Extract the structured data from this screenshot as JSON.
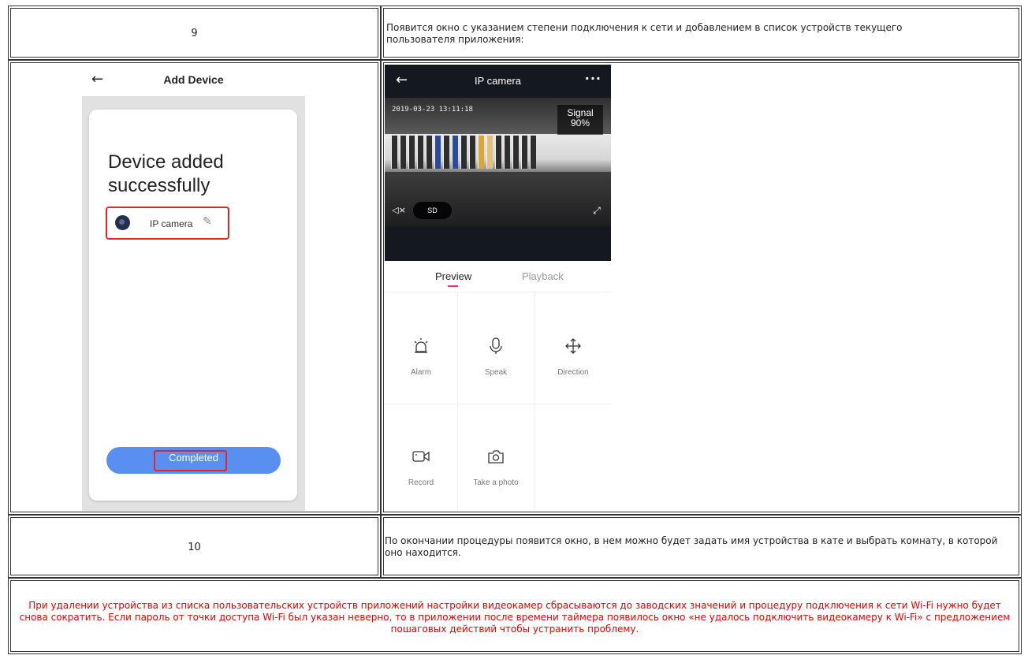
{
  "rows": [
    {
      "number": "9",
      "text": "Появится окно с указанием степени подключения к сети и добавлением в список устройств текущего пользователя приложения:"
    },
    {
      "number": "10",
      "text": "По окончании процедуры появится окно, в нем можно будет задать имя устройства в кате и выбрать комнату, в которой оно находится."
    }
  ],
  "phone_left": {
    "title": "Add Device",
    "heading_line1": "Device added",
    "heading_line2": "successfully",
    "device_name": "IP camera",
    "button_label": "Completed",
    "icons": {
      "back": "arrow-left-icon",
      "camera": "camera-lens-icon",
      "edit": "pencil-icon"
    }
  },
  "phone_right": {
    "title": "IP camera",
    "more": "···",
    "timestamp": "2019-03-23 13:11:18",
    "signal_label": "Signal",
    "signal_value": "90%",
    "quality_button": "SD",
    "tabs": {
      "preview": "Preview",
      "playback": "Playback"
    },
    "actions": {
      "alarm": "Alarm",
      "speak": "Speak",
      "direction": "Direction",
      "record": "Record",
      "photo": "Take a photo"
    },
    "colors": {
      "header": "#16181f",
      "tab_accent": "#e8326a"
    }
  },
  "note": "При удалении устройства из списка пользовательских устройств приложений настройки видеокамер сбрасываются до заводских значений и процедуру подключения к сети Wi-Fi нужно будет снова сократить. Если пароль от точки доступа Wi-Fi был указан неверно, то в приложении после времени таймера появилось окно «не удалось подключить видеокамеру к Wi-Fi» с предложением пошаговых действий чтобы устранить проблему.",
  "colors": {
    "note_text": "#e30000",
    "highlight_box": "#e3242b",
    "completed_button": "#5a8ff2"
  }
}
